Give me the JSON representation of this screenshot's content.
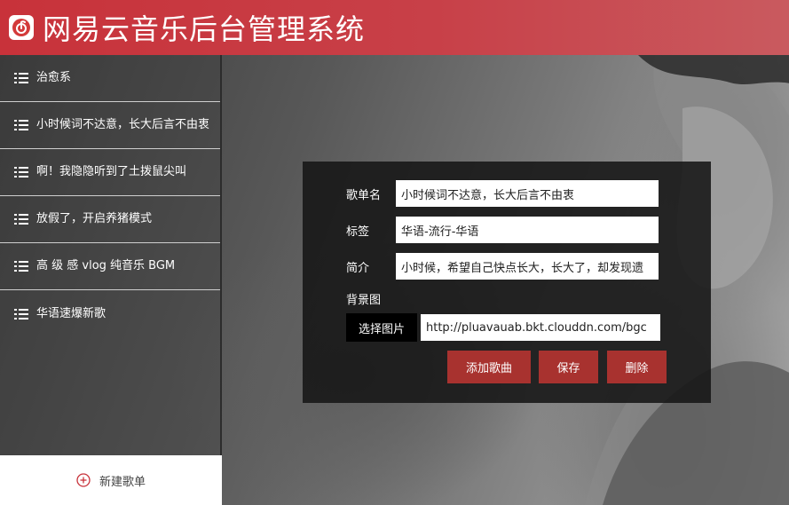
{
  "header": {
    "title": "网易云音乐后台管理系统",
    "logo_icon": "netease-music-logo-icon",
    "brand_color": "#c8323a"
  },
  "sidebar": {
    "items": [
      {
        "label": "治愈系",
        "icon": "list-icon"
      },
      {
        "label": "小时候词不达意，长大后言不由衷",
        "icon": "list-icon"
      },
      {
        "label": "啊！我隐隐听到了土拨鼠尖叫",
        "icon": "list-icon"
      },
      {
        "label": "放假了，开启养猪模式",
        "icon": "list-icon"
      },
      {
        "label": "高 级 感 vlog 纯音乐 BGM",
        "icon": "list-icon"
      },
      {
        "label": "华语速爆新歌",
        "icon": "list-icon"
      }
    ],
    "new_playlist": {
      "label": "新建歌单",
      "icon": "plus-circle-icon"
    }
  },
  "editor": {
    "name_label": "歌单名",
    "name_value": "小时候词不达意，长大后言不由衷",
    "tags_label": "标签",
    "tags_value": "华语-流行-华语",
    "desc_label": "简介",
    "desc_value": "小时候，希望自己快点长大，长大了，却发现遗",
    "bg_label": "背景图",
    "pick_image_label": "选择图片",
    "bg_url_value": "http://pluavauab.bkt.clouddn.com/bgc",
    "add_song_label": "添加歌曲",
    "save_label": "保存",
    "delete_label": "删除",
    "button_color": "#a8322f"
  }
}
